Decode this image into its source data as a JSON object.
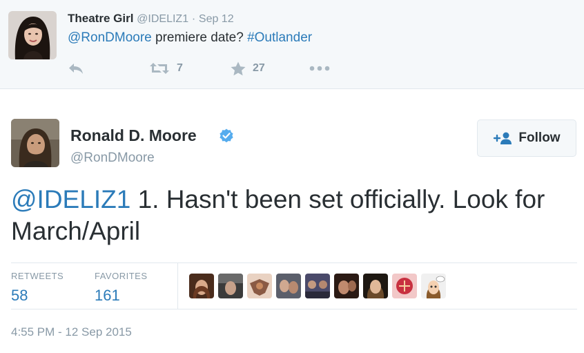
{
  "parent_tweet": {
    "name": "Theatre Girl",
    "handle": "@IDELIZ1",
    "separator": "·",
    "time": "Sep 12",
    "mention": "@RonDMoore",
    "text": "premiere date?",
    "hashtag": "#Outlander",
    "retweet_count": "7",
    "favorite_count": "27"
  },
  "tweet": {
    "name": "Ronald D. Moore",
    "handle": "@RonDMoore",
    "follow_label": "Follow",
    "mention": "@IDELIZ1",
    "text": "1.  Hasn't been set officially. Look for March/April",
    "stats": {
      "retweets_label": "RETWEETS",
      "retweets_value": "58",
      "favorites_label": "FAVORITES",
      "favorites_value": "161"
    },
    "timestamp": "4:55 PM - 12 Sep 2015"
  },
  "icons": {
    "reply": "reply-icon",
    "retweet": "retweet-icon",
    "favorite": "star-icon",
    "more": "more-dots-icon",
    "verified": "verified-badge-icon",
    "follow": "add-user-icon"
  },
  "colors": {
    "link": "#2b7bb9",
    "verified": "#55acee",
    "muted": "#8899a6",
    "action": "#aab8c2"
  }
}
